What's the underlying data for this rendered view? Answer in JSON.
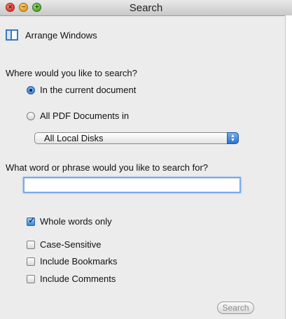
{
  "window": {
    "title": "Search"
  },
  "arrange": {
    "label": "Arrange Windows",
    "icon": "arrange-windows-icon"
  },
  "where": {
    "question": "Where would you like to search?",
    "options": [
      {
        "label": "In the current document",
        "selected": true
      },
      {
        "label": "All PDF Documents in",
        "selected": false
      }
    ],
    "location_select": {
      "value": "All Local Disks"
    }
  },
  "query": {
    "question": "What word or phrase would you like to search for?",
    "value": "",
    "placeholder": ""
  },
  "options": {
    "whole_words": {
      "label": "Whole words only",
      "checked": true
    },
    "case_sensitive": {
      "label": "Case-Sensitive",
      "checked": false
    },
    "include_bookmarks": {
      "label": "Include Bookmarks",
      "checked": false
    },
    "include_comments": {
      "label": "Include Comments",
      "checked": false
    }
  },
  "actions": {
    "search_label": "Search"
  },
  "colors": {
    "accent": "#2f7fd6",
    "background": "#ececec",
    "close": "#d8312a",
    "minimize": "#e09a19",
    "zoom": "#4da426"
  }
}
